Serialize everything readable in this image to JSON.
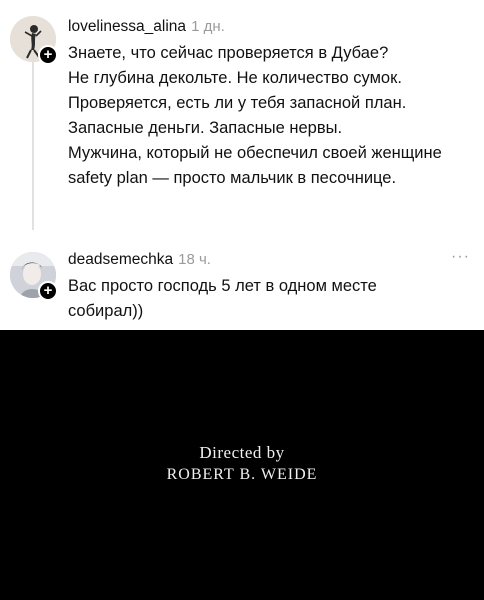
{
  "comments": [
    {
      "username": "lovelinessa_alina",
      "time": "1 дн.",
      "lines": [
        "Знаете, что сейчас проверяется в Дубае?",
        "Не глубина декольте. Не количество сумок.",
        "Проверяется, есть ли у тебя запасной план.",
        "Запасные деньги. Запасные нервы.",
        "Мужчина, который не обеспечил своей женщине",
        "safety plan — просто мальчик в песочнице."
      ]
    },
    {
      "username": "deadsemechka",
      "time": "18 ч.",
      "lines": [
        "Вас просто господь 5 лет в одном месте",
        "собирал))"
      ]
    }
  ],
  "plus_symbol": "+",
  "more_symbol": "···",
  "video": {
    "line1": "Directed by",
    "line2": "ROBERT B. WEIDE"
  }
}
